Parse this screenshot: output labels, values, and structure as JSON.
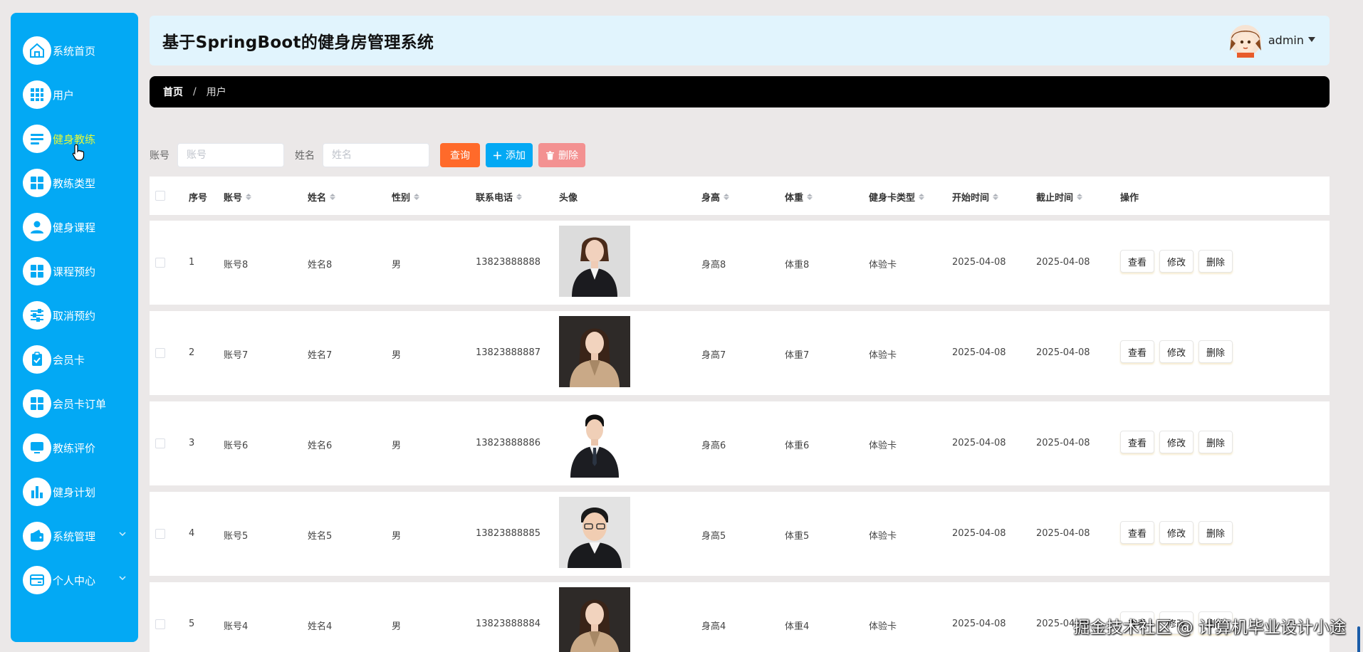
{
  "sidebar": {
    "items": [
      {
        "label": "系统首页",
        "icon": "home-icon"
      },
      {
        "label": "用户",
        "icon": "grid-icon"
      },
      {
        "label": "健身教练",
        "icon": "list-icon"
      },
      {
        "label": "教练类型",
        "icon": "grid-icon"
      },
      {
        "label": "健身课程",
        "icon": "user-icon"
      },
      {
        "label": "课程预约",
        "icon": "grid-icon"
      },
      {
        "label": "取消预约",
        "icon": "sliders-icon"
      },
      {
        "label": "会员卡",
        "icon": "clipboard-icon"
      },
      {
        "label": "会员卡订单",
        "icon": "grid-icon"
      },
      {
        "label": "教练评价",
        "icon": "monitor-icon"
      },
      {
        "label": "健身计划",
        "icon": "bar-chart-icon"
      },
      {
        "label": "系统管理",
        "icon": "wallet-icon"
      },
      {
        "label": "个人中心",
        "icon": "card-icon"
      }
    ]
  },
  "header": {
    "title": "基于SpringBoot的健身房管理系统",
    "username": "admin"
  },
  "breadcrumb": {
    "home": "首页",
    "separator": "/",
    "current": "用户"
  },
  "search": {
    "account_label": "账号",
    "account_placeholder": "账号",
    "name_label": "姓名",
    "name_placeholder": "姓名",
    "query_button": "查询",
    "add_button": "添加",
    "delete_button": "删除"
  },
  "table": {
    "columns": [
      "序号",
      "账号",
      "姓名",
      "性别",
      "联系电话",
      "头像",
      "身高",
      "体重",
      "健身卡类型",
      "开始时间",
      "截止时间",
      "操作"
    ],
    "actions": {
      "view": "查看",
      "edit": "修改",
      "delete": "删除"
    },
    "rows": [
      {
        "index": "1",
        "account": "账号8",
        "name": "姓名8",
        "gender": "男",
        "phone": "13823888888",
        "height": "身高8",
        "weight": "体重8",
        "card_type": "体验卡",
        "start": "2025-04-08",
        "end": "2025-04-08"
      },
      {
        "index": "2",
        "account": "账号7",
        "name": "姓名7",
        "gender": "男",
        "phone": "13823888887",
        "height": "身高7",
        "weight": "体重7",
        "card_type": "体验卡",
        "start": "2025-04-08",
        "end": "2025-04-08"
      },
      {
        "index": "3",
        "account": "账号6",
        "name": "姓名6",
        "gender": "男",
        "phone": "13823888886",
        "height": "身高6",
        "weight": "体重6",
        "card_type": "体验卡",
        "start": "2025-04-08",
        "end": "2025-04-08"
      },
      {
        "index": "4",
        "account": "账号5",
        "name": "姓名5",
        "gender": "男",
        "phone": "13823888885",
        "height": "身高5",
        "weight": "体重5",
        "card_type": "体验卡",
        "start": "2025-04-08",
        "end": "2025-04-08"
      },
      {
        "index": "5",
        "account": "账号4",
        "name": "姓名4",
        "gender": "男",
        "phone": "13823888884",
        "height": "身高4",
        "weight": "体重4",
        "card_type": "体验卡",
        "start": "2025-04-08",
        "end": "2025-04-08"
      }
    ]
  },
  "watermark": "掘金技术社区 @ 计算机毕业设计小途",
  "colors": {
    "sidebar": "#03a9f4",
    "header_bg": "#e1f4fd",
    "breadcrumb_bg": "#000000",
    "query_button": "#ff6a2a",
    "add_button": "#03a9f4",
    "delete_button": "#f39191",
    "active_menu_text": "#e3f93a"
  }
}
